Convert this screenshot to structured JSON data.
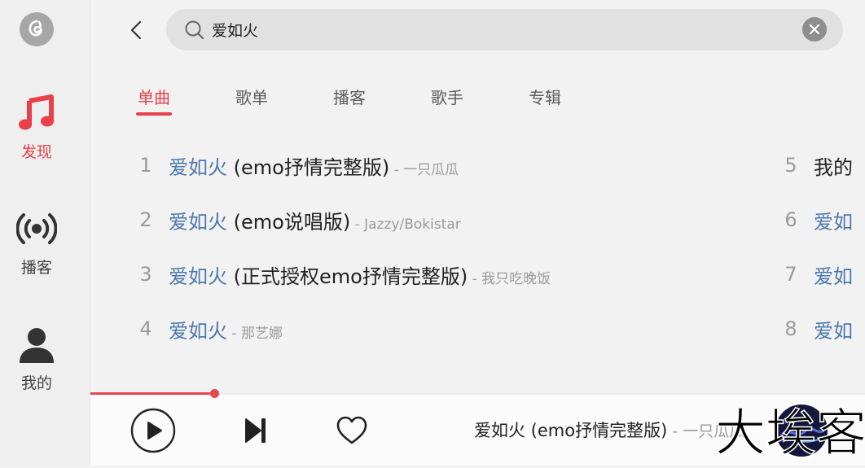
{
  "sidebar": {
    "items": [
      {
        "label": "发现",
        "icon": "music-note-icon",
        "active": true
      },
      {
        "label": "播客",
        "icon": "broadcast-icon",
        "active": false
      },
      {
        "label": "我的",
        "icon": "user-icon",
        "active": false
      }
    ]
  },
  "search": {
    "query": "爱如火"
  },
  "tabs": [
    "单曲",
    "歌单",
    "播客",
    "歌手",
    "专辑"
  ],
  "songs": [
    {
      "num": "1",
      "keyword": "爱如火",
      "suffix": " (emo抒情完整版)",
      "artist": " - 一只瓜瓜"
    },
    {
      "num": "2",
      "keyword": "爱如火",
      "suffix": " (emo说唱版)",
      "artist": " - Jazzy/Bokistar"
    },
    {
      "num": "3",
      "keyword": "爱如火",
      "suffix": " (正式授权emo抒情完整版)",
      "artist": " - 我只吃晚饭"
    },
    {
      "num": "4",
      "keyword": "爱如火",
      "suffix": "",
      "artist": " - 那艺娜"
    },
    {
      "num": "5",
      "keyword": "",
      "suffix": "我的",
      "artist": ""
    },
    {
      "num": "6",
      "keyword": "爱如",
      "suffix": "",
      "artist": ""
    },
    {
      "num": "7",
      "keyword": "爱如",
      "suffix": "",
      "artist": ""
    },
    {
      "num": "8",
      "keyword": "爱如",
      "suffix": "",
      "artist": ""
    }
  ],
  "player": {
    "title": "爱如火 (emo抒情完整版)",
    "artist": " - 一只瓜瓜",
    "progress": 0.16
  },
  "watermark": {
    "text": "大埃客"
  },
  "colors": {
    "accent": "#e8414b",
    "keyword": "#4a78b0"
  }
}
